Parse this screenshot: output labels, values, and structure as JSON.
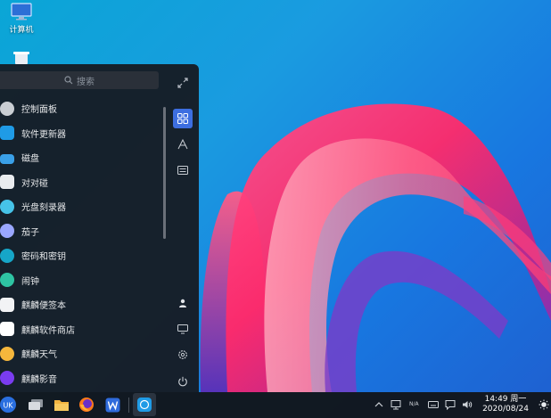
{
  "desktop": {
    "icons": [
      {
        "label": "计算机",
        "icon": "computer-icon"
      },
      {
        "label": "",
        "icon": "trash-icon"
      }
    ]
  },
  "start_menu": {
    "search_placeholder": "搜索",
    "apps": [
      {
        "label": "控制面板",
        "icon": "control-panel-icon",
        "color": "#c9ced3"
      },
      {
        "label": "软件更新器",
        "icon": "software-updater-icon",
        "color": "#1f9be6"
      },
      {
        "label": "磁盘",
        "icon": "disk-icon",
        "color": "#3aa0e8"
      },
      {
        "label": "对对碰",
        "icon": "match-game-icon",
        "color": "#e9ecef"
      },
      {
        "label": "光盘刻录器",
        "icon": "disc-burner-icon",
        "color": "#46c3e8"
      },
      {
        "label": "茄子",
        "icon": "cheese-camera-icon",
        "color": "#9aa7ff"
      },
      {
        "label": "密码和密钥",
        "icon": "passwords-keys-icon",
        "color": "#16a6c8"
      },
      {
        "label": "闹钟",
        "icon": "alarm-clock-icon",
        "color": "#2ec4a3"
      },
      {
        "label": "麒麟便签本",
        "icon": "notes-icon",
        "color": "#f2f3f5"
      },
      {
        "label": "麒麟软件商店",
        "icon": "software-store-icon",
        "color": "#ffffff"
      },
      {
        "label": "麒麟天气",
        "icon": "weather-icon",
        "color": "#f6b73c"
      },
      {
        "label": "麒麟影音",
        "icon": "video-player-icon",
        "color": "#7a3cf0"
      }
    ],
    "side_buttons": [
      "all-apps-icon",
      "letter-sort-icon",
      "category-icon",
      "user-icon",
      "computer-icon",
      "settings-icon",
      "power-icon"
    ]
  },
  "taskbar": {
    "apps": [
      "start-menu-logo-icon",
      "multitask-view-icon",
      "file-manager-icon",
      "firefox-icon",
      "wps-writer-icon",
      "software-updater-taskbar-icon"
    ],
    "tray": {
      "input_method": "N/A"
    },
    "clock": {
      "time_day": "14:49 周一",
      "date": "2020/08/24"
    }
  },
  "colors": {
    "accent": "#3d6ee0",
    "menu_bg": "#161c24",
    "taskbar_bg": "#12161c"
  }
}
